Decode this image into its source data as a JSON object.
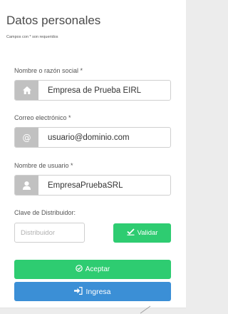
{
  "header": {
    "title": "Datos personales",
    "subtitle": "Campos con * son requeridos"
  },
  "fields": {
    "razon_social": {
      "label": "Nombre o razón social *",
      "value": "Empresa de Prueba EIRL",
      "icon": "home-icon"
    },
    "email": {
      "label": "Correo electrónico *",
      "value": "usuario@dominio.com",
      "icon": "at-icon",
      "icon_glyph": "@"
    },
    "username": {
      "label": "Nombre de usuario *",
      "value": "EmpresaPruebaSRL",
      "icon": "user-icon"
    },
    "distribuidor": {
      "label": "Clave de Distribuidor:",
      "placeholder": "Distribuidor",
      "value": ""
    }
  },
  "buttons": {
    "validar": {
      "label": "Validar",
      "icon": "check-icon",
      "color": "#2ecc71"
    },
    "aceptar": {
      "label": "Aceptar",
      "icon": "check-circle-icon",
      "color": "#2ecc71"
    },
    "ingresa": {
      "label": "Ingresa",
      "icon": "sign-in-icon",
      "color": "#3b8fd6"
    }
  },
  "colors": {
    "addon_bg": "#c1c1c1",
    "card_bg": "#ffffff",
    "page_bg": "#ececec"
  }
}
